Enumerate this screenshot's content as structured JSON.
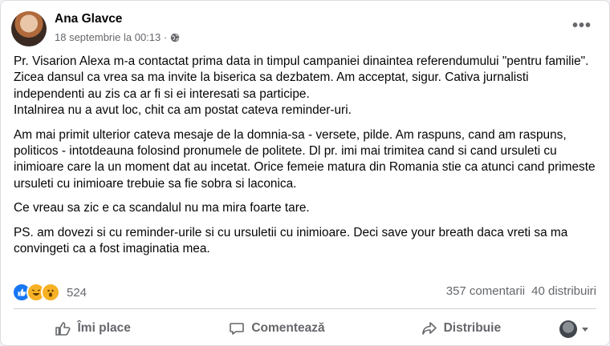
{
  "post": {
    "author": "Ana Glavce",
    "timestamp": "18 septembrie la 00:13 ·",
    "privacy_icon": "globe-icon",
    "paragraphs": [
      "Pr. Visarion Alexa m-a contactat prima data in timpul campaniei dinaintea referendumului \"pentru familie\". Zicea dansul ca vrea sa ma invite la biserica sa dezbatem. Am acceptat, sigur. Cativa jurnalisti independenti au zis ca ar fi si ei interesati sa participe.\nIntalnirea nu a avut loc, chit ca am postat cateva reminder-uri.",
      "Am mai primit ulterior cateva mesaje de la domnia-sa - versete, pilde. Am raspuns, cand am raspuns, politicos - intotdeauna folosind pronumele de politete. Dl pr. imi mai trimitea cand si cand ursuleti cu inimioare care la un moment dat au incetat. Orice femeie matura din Romania stie ca atunci cand primeste ursuleti cu inimioare trebuie sa fie sobra si laconica.",
      "Ce vreau sa zic e ca scandalul nu ma mira foarte tare.",
      "PS. am dovezi si cu reminder-urile si cu ursuletii cu inimioare. Deci save your breath daca vreti sa ma convingeti ca a fost imaginatia mea."
    ]
  },
  "engagement": {
    "reaction_count": "524",
    "reactions": [
      "like-icon",
      "haha-icon",
      "wow-icon"
    ],
    "comments": "357 comentarii",
    "shares": "40 distribuiri"
  },
  "actions": {
    "like": "Îmi place",
    "comment": "Comentează",
    "share": "Distribuie"
  },
  "colors": {
    "like_blue": "#1877f2",
    "reaction_yellow": "#f7b125",
    "meta_gray": "#65676b"
  }
}
